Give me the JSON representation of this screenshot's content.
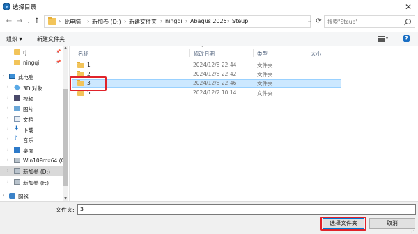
{
  "window": {
    "title": "选择目录",
    "close": "✕"
  },
  "nav": {
    "back": "←",
    "forward": "→",
    "recent": "⌄",
    "up": "↑",
    "dropdown": "⌄",
    "refresh": "⟳"
  },
  "address": {
    "breadcrumbs": [
      "此电脑",
      "新加卷 (D:)",
      "新建文件夹",
      "ningqi",
      "Abaqus 2025",
      "Steup"
    ],
    "separator": "›"
  },
  "search": {
    "placeholder": "搜索\"Steup\""
  },
  "toolbar": {
    "organize": "组织 ▾",
    "new_folder": "新建文件夹",
    "view_dropdown": "▾",
    "help": "?"
  },
  "sidebar": {
    "quick_access": [
      {
        "label": "rj",
        "icon": "folder-icon"
      },
      {
        "label": "ningqi",
        "icon": "folder-icon"
      }
    ],
    "this_pc": {
      "label": "此电脑",
      "icon": "computer-icon"
    },
    "pc_items": [
      {
        "label": "3D 对象",
        "icon": "3d-objects-icon"
      },
      {
        "label": "视频",
        "icon": "video-icon"
      },
      {
        "label": "图片",
        "icon": "pictures-icon"
      },
      {
        "label": "文档",
        "icon": "documents-icon"
      },
      {
        "label": "下载",
        "icon": "download-icon"
      },
      {
        "label": "音乐",
        "icon": "music-icon"
      },
      {
        "label": "桌面",
        "icon": "desktop-icon"
      },
      {
        "label": "Win10Prox64 (C",
        "icon": "drive-icon"
      },
      {
        "label": "新加卷 (D:)",
        "icon": "drive-icon"
      },
      {
        "label": "新加卷 (F:)",
        "icon": "drive-icon"
      }
    ],
    "network": {
      "label": "网络",
      "icon": "network-icon"
    },
    "pin_glyph": "📌",
    "chevron": "›",
    "scroll_up": "▲",
    "scroll_down": "▼"
  },
  "file_list": {
    "columns": [
      "名称",
      "修改日期",
      "类型",
      "大小"
    ],
    "sort_glyph": "^",
    "rows": [
      {
        "name": "1",
        "date": "2024/12/8 22:44",
        "type": "文件夹",
        "size": ""
      },
      {
        "name": "2",
        "date": "2024/12/8 22:42",
        "type": "文件夹",
        "size": ""
      },
      {
        "name": "3",
        "date": "2024/12/8 22:46",
        "type": "文件夹",
        "size": "",
        "selected": true
      },
      {
        "name": "5",
        "date": "2024/12/2 10:14",
        "type": "文件夹",
        "size": ""
      }
    ]
  },
  "bottom": {
    "folder_label": "文件夹:",
    "folder_value": "3",
    "select_button": "选择文件夹",
    "cancel_button": "取消"
  },
  "colors": {
    "selection": "#cce8ff",
    "highlight_box": "#e0232a",
    "folder": "#f2c45a"
  }
}
